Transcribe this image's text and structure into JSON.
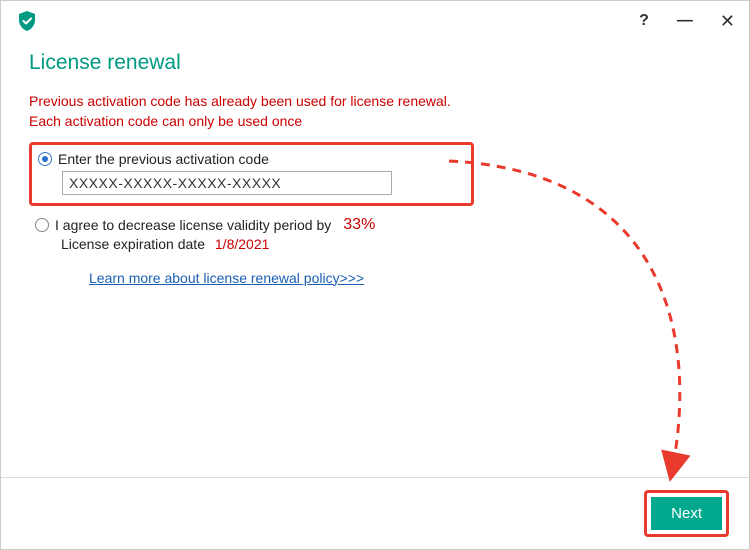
{
  "titlebar": {
    "help_label": "?",
    "minimize_label": "—",
    "close_label": "✕"
  },
  "page": {
    "title": "License renewal"
  },
  "error": {
    "line1": "Previous activation code has already been used for license renewal.",
    "line2": "Each activation code can only be used once"
  },
  "option1": {
    "label": "Enter the previous activation code",
    "code_value": "XXXXX-XXXXX-XXXXX-XXXXX"
  },
  "option2": {
    "label": "I agree to decrease license validity period by",
    "percent": "33%",
    "expiration_label": "License expiration date",
    "expiration_date": "1/8/2021"
  },
  "link": {
    "learn_more": "Learn more about license renewal policy>>>"
  },
  "footer": {
    "next_label": "Next"
  }
}
